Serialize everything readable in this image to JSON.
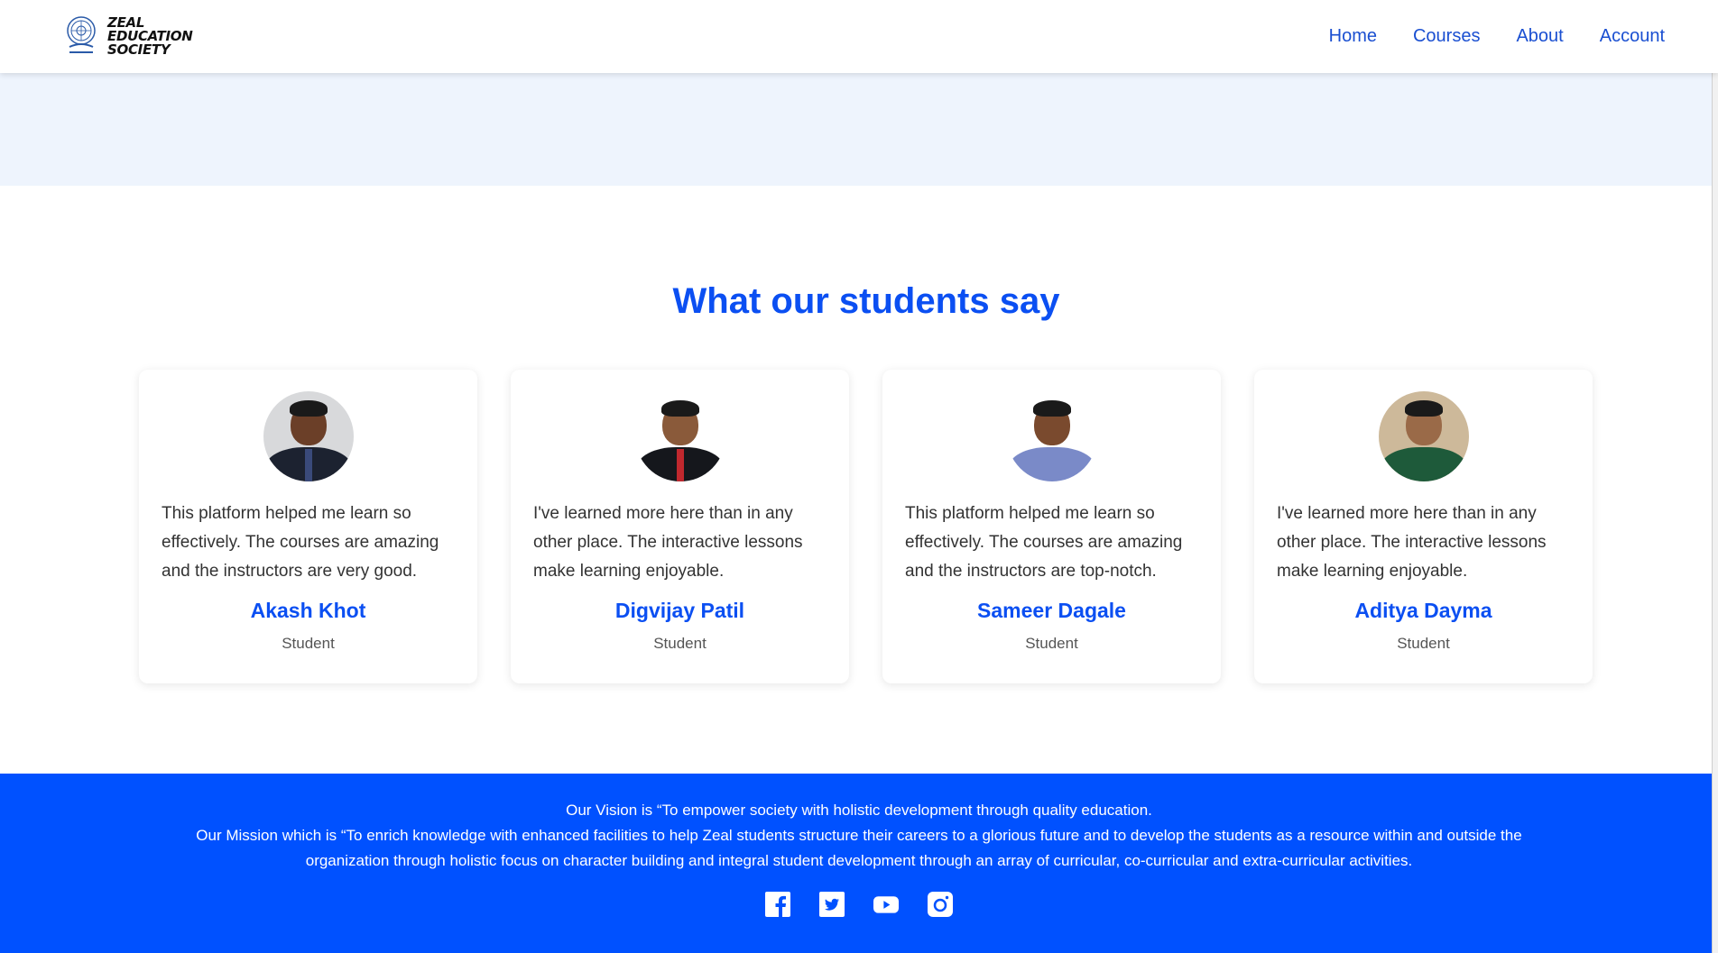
{
  "brand": {
    "name_line1": "ZEAL",
    "name_line2": "EDUCATION",
    "name_line3": "SOCIETY",
    "colors": {
      "primary": "#0b4ff2",
      "footer": "#0051ff",
      "hero": "#eef4fd"
    }
  },
  "nav": {
    "items": [
      {
        "label": "Home"
      },
      {
        "label": "Courses"
      },
      {
        "label": "About"
      },
      {
        "label": "Account"
      }
    ]
  },
  "testimonials": {
    "title": "What our students say",
    "items": [
      {
        "quote": "This platform helped me learn so effectively. The courses are amazing and the instructors are very good.",
        "name": "Akash Khot",
        "role": "Student"
      },
      {
        "quote": "I've learned more here than in any other place. The interactive lessons make learning enjoyable.",
        "name": "Digvijay Patil",
        "role": "Student"
      },
      {
        "quote": "This platform helped me learn so effectively. The courses are amazing and the instructors are top-notch.",
        "name": "Sameer Dagale",
        "role": "Student"
      },
      {
        "quote": "I've learned more here than in any other place. The interactive lessons make learning enjoyable.",
        "name": "Aditya Dayma",
        "role": "Student"
      }
    ]
  },
  "footer": {
    "vision": "Our Vision is “To empower society with holistic development through quality education.",
    "mission": "Our Mission which is “To enrich knowledge with enhanced facilities to help Zeal students structure their careers to a glorious future and to develop the students as a resource within and outside the organization through holistic focus on character building and integral student development through an array of curricular, co-curricular and extra-curricular activities.",
    "socials": [
      "facebook-icon",
      "twitter-icon",
      "youtube-icon",
      "instagram-icon"
    ]
  }
}
